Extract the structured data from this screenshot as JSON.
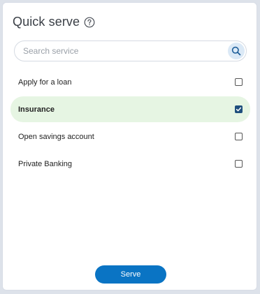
{
  "header": {
    "title": "Quick serve",
    "help_icon": "help-circle-icon"
  },
  "search": {
    "placeholder": "Search service",
    "value": "",
    "icon": "search-icon"
  },
  "services": [
    {
      "label": "Apply for a loan",
      "checked": false
    },
    {
      "label": "Insurance",
      "checked": true
    },
    {
      "label": "Open savings account",
      "checked": false
    },
    {
      "label": "Private Banking",
      "checked": false
    }
  ],
  "footer": {
    "serve_label": "Serve"
  },
  "colors": {
    "accent": "#0a74c4",
    "selected_row": "#e6f5e3",
    "checkbox_checked": "#1f4f7d"
  }
}
